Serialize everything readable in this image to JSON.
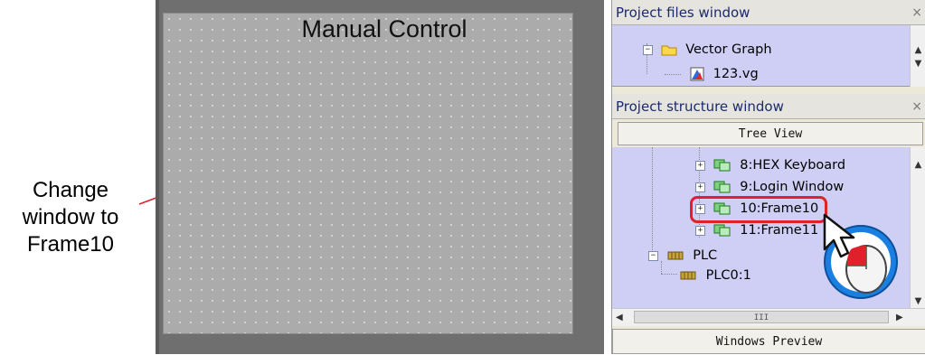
{
  "annotation": {
    "text": "Change\nwindow to\nFrame10"
  },
  "editor": {
    "canvas_title": "Manual Control"
  },
  "project_files": {
    "title": "Project files window",
    "close_glyph": "×",
    "items": [
      {
        "label": "Vector Graph",
        "icon": "folder-icon"
      },
      {
        "label": "123.vg",
        "icon": "vector-graph-file-icon"
      }
    ]
  },
  "project_structure": {
    "title": "Project structure window",
    "close_glyph": "×",
    "tree_view_label": "Tree View",
    "items": [
      {
        "label": "8:HEX Keyboard",
        "icon": "window-icon"
      },
      {
        "label": "9:Login Window",
        "icon": "window-icon"
      },
      {
        "label": "10:Frame10",
        "icon": "window-icon",
        "highlighted": true
      },
      {
        "label": "11:Frame11",
        "icon": "window-icon"
      },
      {
        "label": "PLC",
        "icon": "plc-icon"
      },
      {
        "label": "PLC0:1",
        "icon": "plc-icon"
      }
    ],
    "hscroll_grip": "III",
    "preview_label": "Windows Preview"
  },
  "colors": {
    "highlight_border": "#e0202a",
    "annotation_line": "#e0202a",
    "mouse_blue": "#1a7fe0"
  }
}
